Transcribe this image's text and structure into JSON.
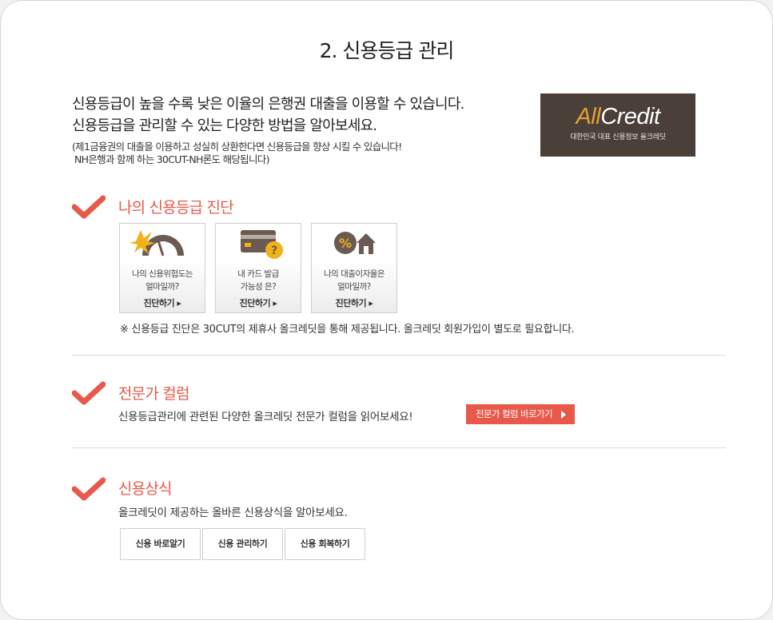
{
  "page": {
    "title": "2. 신용등급 관리"
  },
  "intro": {
    "line1": "신용등급이 높을 수록 낮은 이율의 은행권 대출을 이용할 수 있습니다.",
    "line2": "신용등급을 관리할 수 있는 다양한 방법을 알아보세요.",
    "note1": "(제1금융권의 대출을 이용하고 성실히 상환한다면 신용등급을 향상 시킬 수 있습니다!",
    "note2": "NH은행과 함께 하는 30CUT-NH론도 해당됩니다)"
  },
  "logo": {
    "all": "All",
    "credit": "Credit",
    "tagline": "대한민국 대표 신용정보 올크레딧"
  },
  "diagnosis": {
    "title": "나의 신용등급 진단",
    "cards": [
      {
        "icon": "speedometer-icon",
        "line1": "나의 신용위험도는",
        "line2": "얼마일까?",
        "action": "진단하기 ▸"
      },
      {
        "icon": "credit-card-question-icon",
        "line1": "내 카드 발급",
        "line2": "가능성 은?",
        "action": "진단하기 ▸"
      },
      {
        "icon": "percent-house-icon",
        "line1": "나의 대출이자율은",
        "line2": "얼마일까?",
        "action": "진단하기 ▸"
      }
    ],
    "disclaimer": "※ 신용등급 진단은 30CUT의 제휴사 올크레딧을 통해 제공됩니다. 올크레딧 회원가입이 별도로 필요합니다."
  },
  "column": {
    "title": "전문가 컬럼",
    "desc": "신용등급관리에 관련된 다양한 올크레딧 전문가 컬럼을 읽어보세요!",
    "button": "전문가 컬럼 바로가기"
  },
  "knowledge": {
    "title": "신용상식",
    "desc": "올크레딧이 제공하는 올바른 신용상식을 알아보세요.",
    "tabs": [
      "신용 바로알기",
      "신용 관리하기",
      "신용 회복하기"
    ]
  },
  "colors": {
    "accent": "#e8594b",
    "logo_bg": "#4a3f39",
    "logo_orange": "#e5a033",
    "icon_brown": "#6b5a52"
  }
}
